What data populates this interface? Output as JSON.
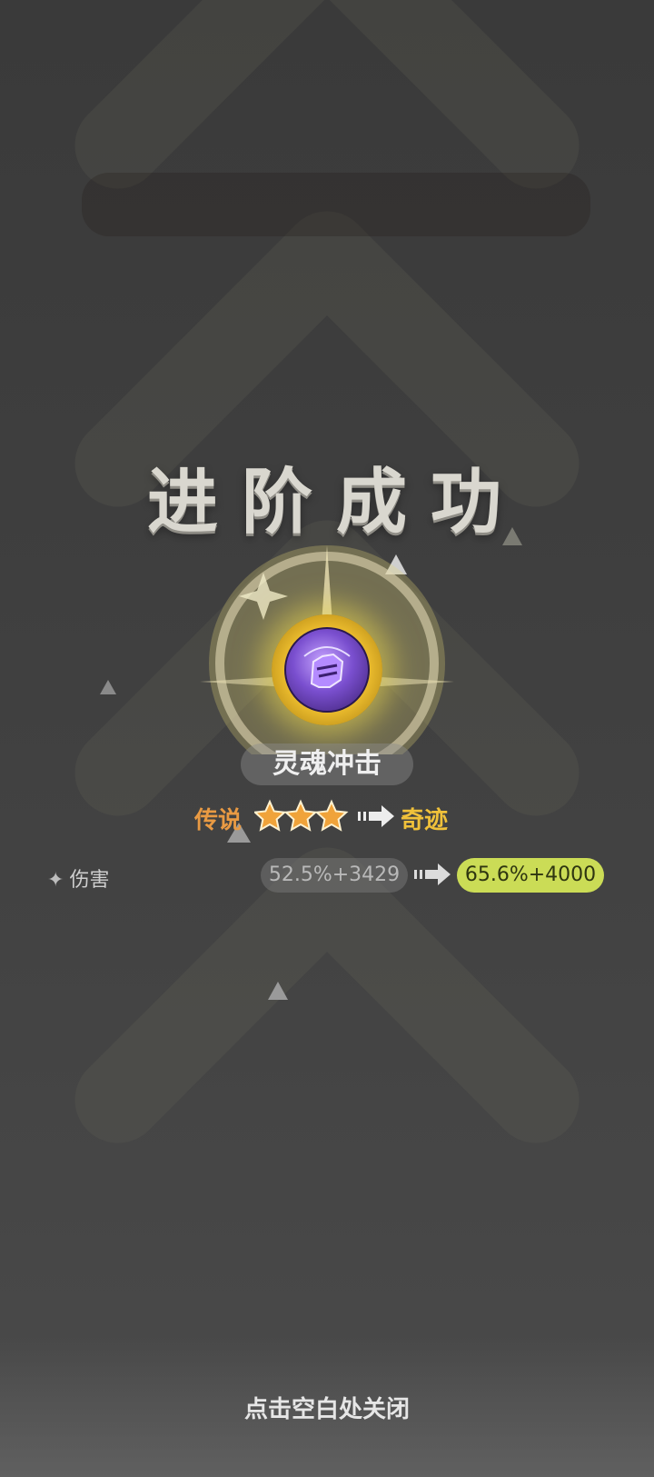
{
  "title": "进阶成功",
  "skill": {
    "name": "灵魂冲击",
    "icon": "soul-strike-skill-icon"
  },
  "rarity": {
    "from": "传说",
    "to": "奇迹",
    "stars": 3,
    "star_color": "#f0a33a",
    "from_color": "#e99a43",
    "to_color": "#f0c13a"
  },
  "stat": {
    "icon": "sparkle-icon",
    "label": "伤害",
    "old_value": "52.5%+3429",
    "new_value": "65.6%+4000",
    "new_value_bg": "#cbdc56"
  },
  "close_hint": "点击空白处关闭"
}
